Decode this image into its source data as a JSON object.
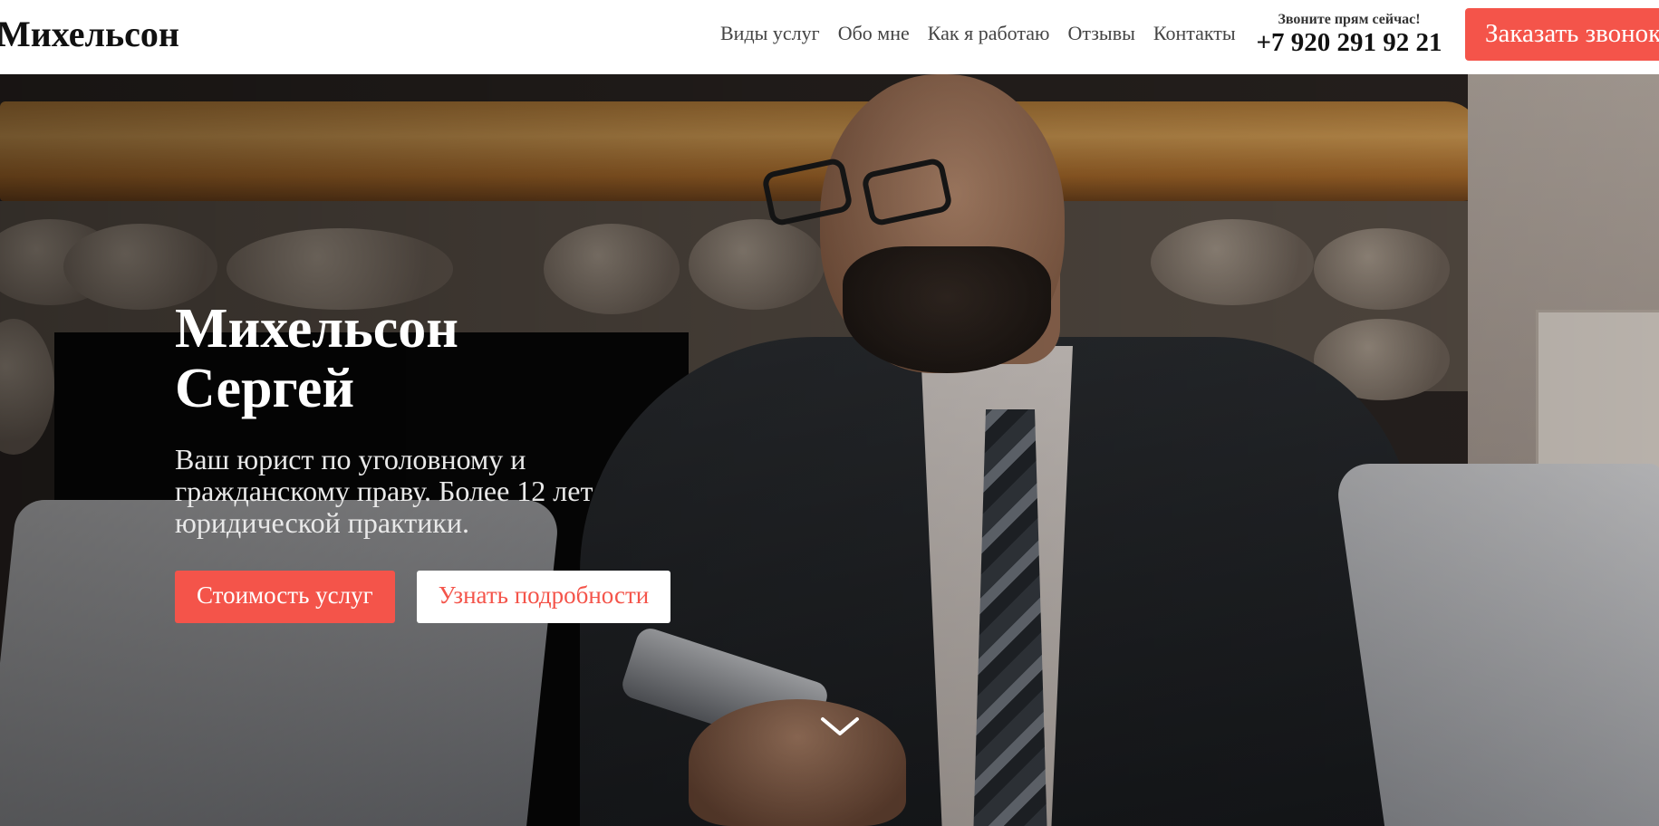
{
  "header": {
    "logo": "Михельсон",
    "nav": {
      "services": "Виды услуг",
      "about": "Обо мне",
      "how_i_work": "Как я работаю",
      "reviews": "Отзывы",
      "contacts": "Контакты"
    },
    "call_caption": "Звоните прям сейчас!",
    "phone": "+7 920 291 92 21",
    "order_call_button": "Заказать звонок"
  },
  "hero": {
    "title_line1": "Михельсон",
    "title_line2": "Сергей",
    "subtitle": "Ваш юрист по уголовному и гражданскому праву. Более 12 лет юридической практики.",
    "primary_button": "Стоимость услуг",
    "secondary_button": "Узнать подробности",
    "scroll_icon": "chevron-down-icon"
  },
  "colors": {
    "accent": "#f4544a",
    "header_bg": "#ffffff",
    "hero_text": "#ffffff"
  }
}
